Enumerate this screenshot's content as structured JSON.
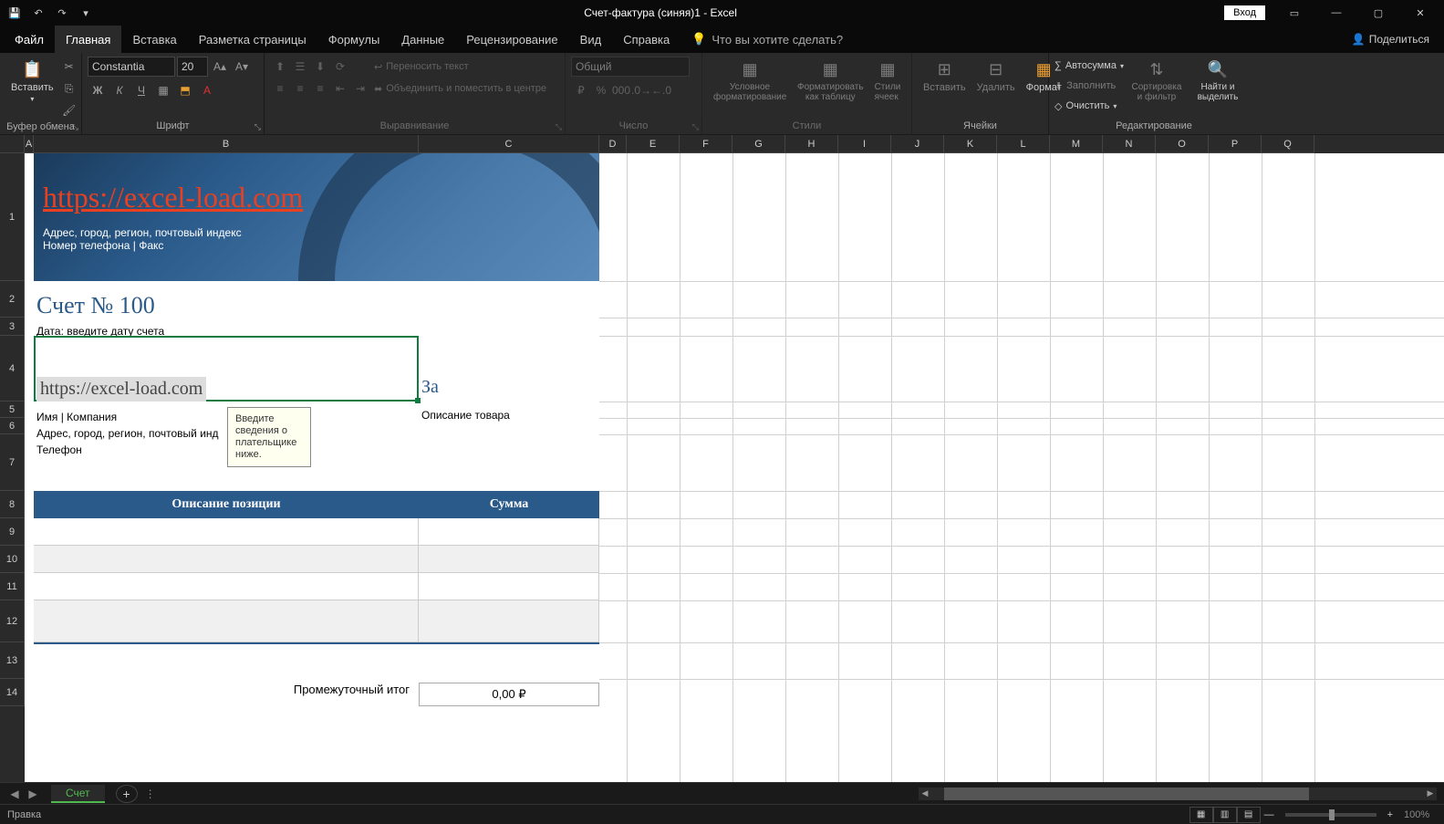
{
  "title_bar": {
    "doc_title": "Счет-фактура (синяя)1 - Excel",
    "login": "Вход"
  },
  "tabs": {
    "file": "Файл",
    "home": "Главная",
    "insert": "Вставка",
    "page_layout": "Разметка страницы",
    "formulas": "Формулы",
    "data": "Данные",
    "review": "Рецензирование",
    "view": "Вид",
    "help": "Справка",
    "tell_me": "Что вы хотите сделать?",
    "share": "Поделиться"
  },
  "ribbon": {
    "clipboard": {
      "label": "Буфер обмена",
      "paste": "Вставить"
    },
    "font": {
      "label": "Шрифт",
      "name": "Constantia",
      "size": "20"
    },
    "alignment": {
      "label": "Выравнивание",
      "wrap": "Переносить текст",
      "merge": "Объединить и поместить в центре"
    },
    "number": {
      "label": "Число",
      "format": "Общий"
    },
    "styles": {
      "label": "Стили",
      "conditional": "Условное форматирование",
      "table": "Форматировать как таблицу",
      "cells": "Стили ячеек"
    },
    "cells": {
      "label": "Ячейки",
      "insert": "Вставить",
      "delete": "Удалить",
      "format": "Формат"
    },
    "editing": {
      "label": "Редактирование",
      "autosum": "Автосумма",
      "fill": "Заполнить",
      "clear": "Очистить",
      "sort": "Сортировка и фильтр",
      "find": "Найти и выделить"
    }
  },
  "columns": [
    "A",
    "B",
    "C",
    "D",
    "E",
    "F",
    "G",
    "H",
    "I",
    "J",
    "K",
    "L",
    "M",
    "N",
    "O",
    "P",
    "Q"
  ],
  "rows": [
    "1",
    "2",
    "3",
    "4",
    "5",
    "6",
    "7",
    "8",
    "9",
    "10",
    "11",
    "12",
    "13",
    "14"
  ],
  "invoice": {
    "url": "https://excel-load.com",
    "addr1": "Адрес, город, регион, почтовый индекс",
    "addr2": "Номер телефона | Факс",
    "title": "Счет № 100",
    "date": "Дата: введите дату счета",
    "bill_to": "https://excel-load.com",
    "za": "За",
    "name_company": "Имя | Компания",
    "address": "Адрес, город, регион, почтовый инд",
    "phone": "Телефон",
    "za_desc": "Описание товара",
    "tooltip": "Введите сведения о плательщике ниже.",
    "col_desc": "Описание позиции",
    "col_sum": "Сумма",
    "subtotal_label": "Промежуточный итог",
    "subtotal_val": "0,00 ₽"
  },
  "sheet": {
    "name": "Счет"
  },
  "status": {
    "mode": "Правка",
    "zoom": "100%"
  }
}
